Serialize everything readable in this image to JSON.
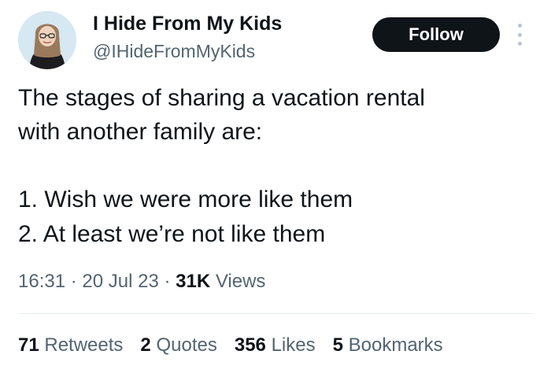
{
  "profile": {
    "display_name": "I Hide From My Kids",
    "handle": "@IHideFromMyKids"
  },
  "actions": {
    "follow_label": "Follow",
    "more_icon": "more-vertical-icon"
  },
  "tweet": {
    "lines": [
      "The stages of sharing a vacation rental",
      "with another family are:",
      "",
      "1. Wish we were more like them",
      "2. At least we’re not like them"
    ]
  },
  "meta": {
    "time": "16:31",
    "separator": " · ",
    "date": "20 Jul 23",
    "views_count": "31K",
    "views_label": " Views"
  },
  "stats": [
    {
      "count": "71",
      "label": "Retweets"
    },
    {
      "count": "2",
      "label": "Quotes"
    },
    {
      "count": "356",
      "label": "Likes"
    },
    {
      "count": "5",
      "label": "Bookmarks"
    }
  ],
  "colors": {
    "text": "#0f1419",
    "secondary": "#536471",
    "button_bg": "#0f1419",
    "button_text": "#ffffff"
  }
}
